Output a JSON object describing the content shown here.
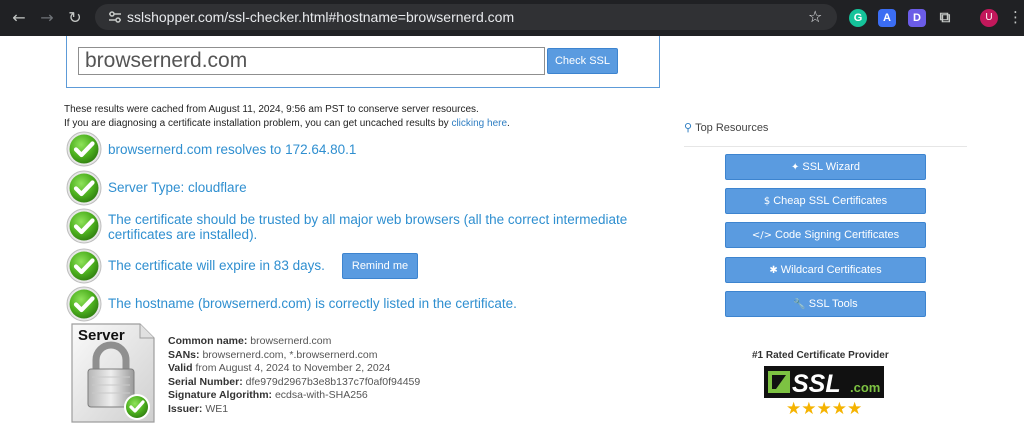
{
  "browser": {
    "url": "sslshopper.com/ssl-checker.html#hostname=browsernerd.com",
    "avatar_letter": "U",
    "ext_labels": [
      "G",
      "A",
      "D"
    ]
  },
  "search": {
    "hostname_value": "browsernerd.com",
    "check_button": "Check SSL"
  },
  "cache_note": {
    "line1": "These results were cached from August 11, 2024, 9:56 am PST to conserve server resources.",
    "line2_prefix": "If you are diagnosing a certificate installation problem, you can get uncached results by ",
    "link": "clicking here",
    "line2_suffix": "."
  },
  "results": [
    "browsernerd.com resolves to 172.64.80.1",
    "Server Type: cloudflare",
    "The certificate should be trusted by all major web browsers (all the correct intermediate",
    "certificates are installed).",
    "The certificate will expire in 83 days.",
    "The hostname (browsernerd.com) is correctly listed in the certificate."
  ],
  "remind_button": "Remind me",
  "server_label": "Server",
  "cert": {
    "common_name_label": "Common name:",
    "common_name": "browsernerd.com",
    "sans_label": "SANs:",
    "sans": "browsernerd.com, *.browsernerd.com",
    "valid_label": "Valid",
    "valid": "from August 4, 2024 to November 2, 2024",
    "serial_label": "Serial Number:",
    "serial": "dfe979d2967b3e8b137c7f0af0f94459",
    "sigalg_label": "Signature Algorithm:",
    "sigalg": "ecdsa-with-SHA256",
    "issuer_label": "Issuer:",
    "issuer": "WE1"
  },
  "sidebar": {
    "title": "Top Resources",
    "buttons": [
      {
        "icon": "wand-icon",
        "glyph": "✦",
        "label": "SSL Wizard"
      },
      {
        "icon": "dollar-icon",
        "glyph": "$",
        "label": "Cheap SSL Certificates"
      },
      {
        "icon": "code-icon",
        "glyph": "</>",
        "label": "Code Signing Certificates"
      },
      {
        "icon": "asterisk-icon",
        "glyph": "✱",
        "label": "Wildcard Certificates"
      },
      {
        "icon": "wrench-icon",
        "glyph": "🔧",
        "label": "SSL Tools"
      }
    ],
    "provider_title": "#1 Rated Certificate Provider",
    "logo_text": "SSL",
    "logo_suffix": ".com",
    "rating_stars": 5
  },
  "colors": {
    "accent": "#2f8fd0",
    "button": "#5a9be0",
    "check_green": "#4caf1e",
    "star": "#f5b301"
  }
}
